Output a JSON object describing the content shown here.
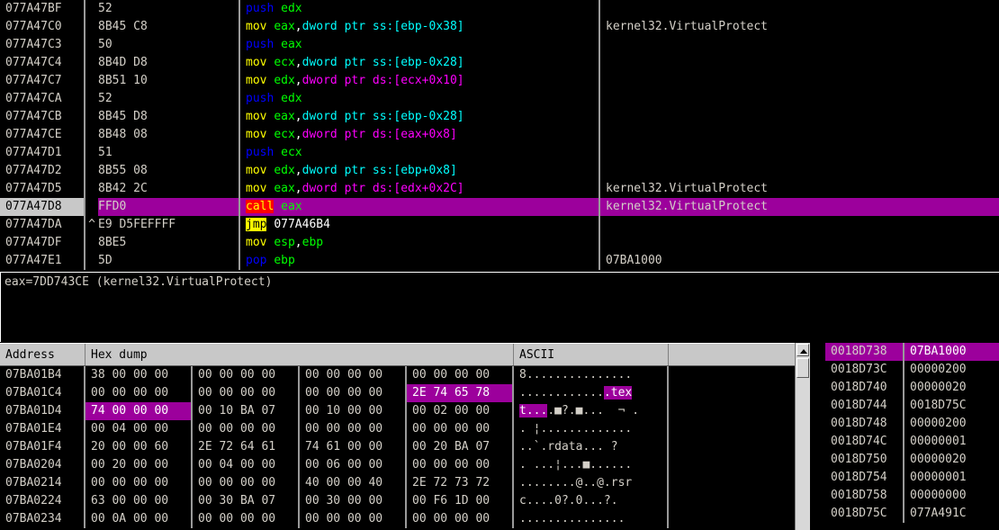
{
  "disassembly": {
    "colors": {
      "selected_bg": "#9c009c",
      "selected_addr_bg": "#c8c8c8",
      "call_fg": "#ffff00",
      "call_bg": "#ff0000",
      "jmp_fg": "#000000",
      "jmp_bg": "#ffff00",
      "register": "#00ff00",
      "ss_operand": "#00ffff",
      "ds_operand": "#ff00ff",
      "mov": "#ffff00",
      "push": "#0000ff",
      "text": "#d4d0c8"
    },
    "rows": [
      {
        "address": "077A47BF",
        "jump": "",
        "bytes": "52",
        "mnemonic": "push",
        "mnemonic_class": "m-push",
        "operands": [
          {
            "t": "edx",
            "c": "reg"
          }
        ],
        "comment": "",
        "selected": false
      },
      {
        "address": "077A47C0",
        "jump": "",
        "bytes": "8B45 C8",
        "mnemonic": "mov",
        "mnemonic_class": "m-mov",
        "operands": [
          {
            "t": "eax",
            "c": "reg"
          },
          {
            "t": ",",
            "c": "pun"
          },
          {
            "t": "dword ptr ss:[ebp-0x38]",
            "c": "ss"
          }
        ],
        "comment": "kernel32.VirtualProtect",
        "selected": false
      },
      {
        "address": "077A47C3",
        "jump": "",
        "bytes": "50",
        "mnemonic": "push",
        "mnemonic_class": "m-push",
        "operands": [
          {
            "t": "eax",
            "c": "reg"
          }
        ],
        "comment": "",
        "selected": false
      },
      {
        "address": "077A47C4",
        "jump": "",
        "bytes": "8B4D D8",
        "mnemonic": "mov",
        "mnemonic_class": "m-mov",
        "operands": [
          {
            "t": "ecx",
            "c": "reg"
          },
          {
            "t": ",",
            "c": "pun"
          },
          {
            "t": "dword ptr ss:[ebp-0x28]",
            "c": "ss"
          }
        ],
        "comment": "",
        "selected": false
      },
      {
        "address": "077A47C7",
        "jump": "",
        "bytes": "8B51 10",
        "mnemonic": "mov",
        "mnemonic_class": "m-mov",
        "operands": [
          {
            "t": "edx",
            "c": "reg"
          },
          {
            "t": ",",
            "c": "pun"
          },
          {
            "t": "dword ptr ds:[ecx+0x10]",
            "c": "ds"
          }
        ],
        "comment": "",
        "selected": false
      },
      {
        "address": "077A47CA",
        "jump": "",
        "bytes": "52",
        "mnemonic": "push",
        "mnemonic_class": "m-push",
        "operands": [
          {
            "t": "edx",
            "c": "reg"
          }
        ],
        "comment": "",
        "selected": false
      },
      {
        "address": "077A47CB",
        "jump": "",
        "bytes": "8B45 D8",
        "mnemonic": "mov",
        "mnemonic_class": "m-mov",
        "operands": [
          {
            "t": "eax",
            "c": "reg"
          },
          {
            "t": ",",
            "c": "pun"
          },
          {
            "t": "dword ptr ss:[ebp-0x28]",
            "c": "ss"
          }
        ],
        "comment": "",
        "selected": false
      },
      {
        "address": "077A47CE",
        "jump": "",
        "bytes": "8B48 08",
        "mnemonic": "mov",
        "mnemonic_class": "m-mov",
        "operands": [
          {
            "t": "ecx",
            "c": "reg"
          },
          {
            "t": ",",
            "c": "pun"
          },
          {
            "t": "dword ptr ds:[eax+0x8]",
            "c": "ds"
          }
        ],
        "comment": "",
        "selected": false
      },
      {
        "address": "077A47D1",
        "jump": "",
        "bytes": "51",
        "mnemonic": "push",
        "mnemonic_class": "m-push",
        "operands": [
          {
            "t": "ecx",
            "c": "reg"
          }
        ],
        "comment": "",
        "selected": false
      },
      {
        "address": "077A47D2",
        "jump": "",
        "bytes": "8B55 08",
        "mnemonic": "mov",
        "mnemonic_class": "m-mov",
        "operands": [
          {
            "t": "edx",
            "c": "reg"
          },
          {
            "t": ",",
            "c": "pun"
          },
          {
            "t": "dword ptr ss:[ebp+0x8]",
            "c": "ss"
          }
        ],
        "comment": "",
        "selected": false
      },
      {
        "address": "077A47D5",
        "jump": "",
        "bytes": "8B42 2C",
        "mnemonic": "mov",
        "mnemonic_class": "m-mov",
        "operands": [
          {
            "t": "eax",
            "c": "reg"
          },
          {
            "t": ",",
            "c": "pun"
          },
          {
            "t": "dword ptr ds:[edx+0x2C]",
            "c": "ds"
          }
        ],
        "comment": "kernel32.VirtualProtect",
        "selected": false
      },
      {
        "address": "077A47D8",
        "jump": "",
        "bytes": "FFD0",
        "mnemonic": "call",
        "mnemonic_class": "m-call",
        "operands": [
          {
            "t": "eax",
            "c": "reg"
          }
        ],
        "comment": "kernel32.VirtualProtect",
        "selected": true
      },
      {
        "address": "077A47DA",
        "jump": "^",
        "bytes": "E9 D5FEFFFF",
        "mnemonic": "jmp",
        "mnemonic_class": "m-jmp",
        "operands": [
          {
            "t": "077A46B4",
            "c": "imm"
          }
        ],
        "comment": "",
        "selected": false
      },
      {
        "address": "077A47DF",
        "jump": "",
        "bytes": "8BE5",
        "mnemonic": "mov",
        "mnemonic_class": "m-mov",
        "operands": [
          {
            "t": "esp",
            "c": "reg"
          },
          {
            "t": ",",
            "c": "pun"
          },
          {
            "t": "ebp",
            "c": "reg"
          }
        ],
        "comment": "",
        "selected": false
      },
      {
        "address": "077A47E1",
        "jump": "",
        "bytes": "5D",
        "mnemonic": "pop",
        "mnemonic_class": "m-pop",
        "operands": [
          {
            "t": "ebp",
            "c": "reg"
          }
        ],
        "comment": "07BA1000",
        "selected": false
      }
    ]
  },
  "info": {
    "lines": [
      "eax=7DD743CE (kernel32.VirtualProtect)"
    ]
  },
  "dump": {
    "headers": {
      "address": "Address",
      "hex": "Hex dump",
      "ascii": "ASCII",
      "pad": ""
    },
    "rows": [
      {
        "address": "07BA01B4",
        "groups": [
          [
            "38",
            "00",
            "00",
            "00"
          ],
          [
            "00",
            "00",
            "00",
            "00"
          ],
          [
            "00",
            "00",
            "00",
            "00"
          ],
          [
            "00",
            "00",
            "00",
            "00"
          ]
        ],
        "group_hl": [
          false,
          false,
          false,
          false
        ],
        "ascii": "8..............."
      },
      {
        "address": "07BA01C4",
        "groups": [
          [
            "00",
            "00",
            "00",
            "00"
          ],
          [
            "00",
            "00",
            "00",
            "00"
          ],
          [
            "00",
            "00",
            "00",
            "00"
          ],
          [
            "2E",
            "74",
            "65",
            "78"
          ]
        ],
        "group_hl": [
          false,
          false,
          false,
          true
        ],
        "ascii": "............",
        "ascii_hl": ".tex"
      },
      {
        "address": "07BA01D4",
        "groups": [
          [
            "74",
            "00",
            "00",
            "00"
          ],
          [
            "00",
            "10",
            "BA",
            "07"
          ],
          [
            "00",
            "10",
            "00",
            "00"
          ],
          [
            "00",
            "02",
            "00",
            "00"
          ]
        ],
        "group_hl": [
          true,
          false,
          false,
          false
        ],
        "ascii_hl_first": "t...",
        "ascii": ".■?.■...  ¬ ."
      },
      {
        "address": "07BA01E4",
        "groups": [
          [
            "00",
            "04",
            "00",
            "00"
          ],
          [
            "00",
            "00",
            "00",
            "00"
          ],
          [
            "00",
            "00",
            "00",
            "00"
          ],
          [
            "00",
            "00",
            "00",
            "00"
          ]
        ],
        "group_hl": [
          false,
          false,
          false,
          false
        ],
        "ascii": ". ¦............."
      },
      {
        "address": "07BA01F4",
        "groups": [
          [
            "20",
            "00",
            "00",
            "60"
          ],
          [
            "2E",
            "72",
            "64",
            "61"
          ],
          [
            "74",
            "61",
            "00",
            "00"
          ],
          [
            "00",
            "20",
            "BA",
            "07"
          ]
        ],
        "group_hl": [
          false,
          false,
          false,
          false
        ],
        "ascii": "..`.rdata... ?"
      },
      {
        "address": "07BA0204",
        "groups": [
          [
            "00",
            "20",
            "00",
            "00"
          ],
          [
            "00",
            "04",
            "00",
            "00"
          ],
          [
            "00",
            "06",
            "00",
            "00"
          ],
          [
            "00",
            "00",
            "00",
            "00"
          ]
        ],
        "group_hl": [
          false,
          false,
          false,
          false
        ],
        "ascii": ". ...¦...■......"
      },
      {
        "address": "07BA0214",
        "groups": [
          [
            "00",
            "00",
            "00",
            "00"
          ],
          [
            "00",
            "00",
            "00",
            "00"
          ],
          [
            "40",
            "00",
            "00",
            "40"
          ],
          [
            "2E",
            "72",
            "73",
            "72"
          ]
        ],
        "group_hl": [
          false,
          false,
          false,
          false
        ],
        "ascii": "........@..@.rsr"
      },
      {
        "address": "07BA0224",
        "groups": [
          [
            "63",
            "00",
            "00",
            "00"
          ],
          [
            "00",
            "30",
            "BA",
            "07"
          ],
          [
            "00",
            "30",
            "00",
            "00"
          ],
          [
            "00",
            "F6",
            "1D",
            "00"
          ]
        ],
        "group_hl": [
          false,
          false,
          false,
          false
        ],
        "ascii": "c....0?.0...?."
      },
      {
        "address": "07BA0234",
        "groups": [
          [
            "00",
            "0A",
            "00",
            "00"
          ],
          [
            "00",
            "00",
            "00",
            "00"
          ],
          [
            "00",
            "00",
            "00",
            "00"
          ],
          [
            "00",
            "00",
            "00",
            "00"
          ]
        ],
        "group_hl": [
          false,
          false,
          false,
          false
        ],
        "ascii": "..............."
      }
    ]
  },
  "stack": {
    "rows": [
      {
        "address": "0018D738",
        "value": "07BA1000",
        "highlight": true
      },
      {
        "address": "0018D73C",
        "value": "00000200",
        "highlight": false
      },
      {
        "address": "0018D740",
        "value": "00000020",
        "highlight": false
      },
      {
        "address": "0018D744",
        "value": "0018D75C",
        "highlight": false
      },
      {
        "address": "0018D748",
        "value": "00000200",
        "highlight": false
      },
      {
        "address": "0018D74C",
        "value": "00000001",
        "highlight": false
      },
      {
        "address": "0018D750",
        "value": "00000020",
        "highlight": false
      },
      {
        "address": "0018D754",
        "value": "00000001",
        "highlight": false
      },
      {
        "address": "0018D758",
        "value": "00000000",
        "highlight": false
      },
      {
        "address": "0018D75C",
        "value": "077A491C",
        "highlight": false
      }
    ]
  },
  "scrollbar": {
    "up_arrow": "scroll-up-arrow"
  }
}
